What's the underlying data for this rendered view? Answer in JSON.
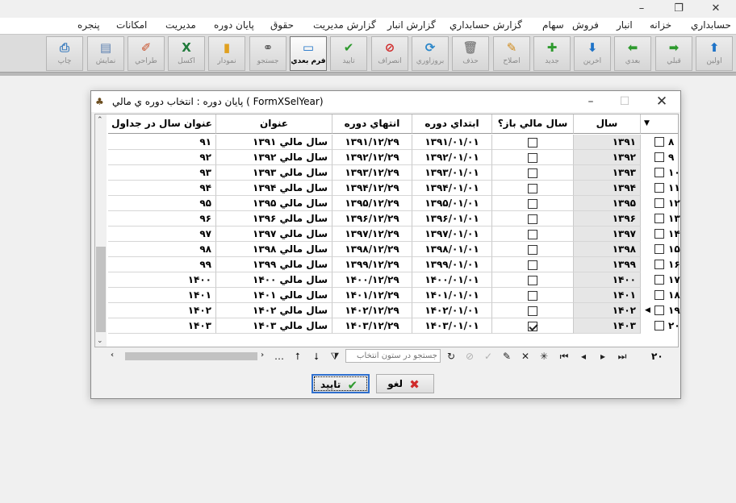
{
  "window": {
    "close_glyph": "✕",
    "restore_glyph": "❐",
    "minimize_glyph": "–"
  },
  "menu": [
    "حسابداري",
    "خزانه",
    "انبار",
    "فروش",
    "سهام",
    "گزارش حسابداري",
    "گزارش انبار",
    "گزارش مديريت",
    "حقوق",
    "پايان دوره",
    "مديريت",
    "امکانات",
    "پنجره"
  ],
  "toolbar": [
    {
      "label": "اولين",
      "icon": "arrow-up-icon",
      "glyph": "⬆",
      "color": "#1e73c8"
    },
    {
      "label": "قبلي",
      "icon": "arrow-right-icon",
      "glyph": "➡",
      "color": "#2e9a2e"
    },
    {
      "label": "بعدي",
      "icon": "arrow-left-icon",
      "glyph": "⬅",
      "color": "#2e9a2e"
    },
    {
      "label": "آخرين",
      "icon": "arrow-down-icon",
      "glyph": "⬇",
      "color": "#1e73c8"
    },
    {
      "label": "جديد",
      "icon": "plus-icon",
      "glyph": "✚",
      "color": "#2e9a2e"
    },
    {
      "label": "اصلاح",
      "icon": "pencil-icon",
      "glyph": "✎",
      "color": "#d08a1a"
    },
    {
      "label": "حذف",
      "icon": "trash-icon",
      "glyph": "🗑",
      "color": "#8a8a8a"
    },
    {
      "label": "بروزآوري",
      "icon": "refresh-icon",
      "glyph": "⟳",
      "color": "#2a86c9"
    },
    {
      "label": "انصراف",
      "icon": "cancel-icon",
      "glyph": "⊘",
      "color": "#d02b2b"
    },
    {
      "label": "تاييد",
      "icon": "check-icon",
      "glyph": "✔",
      "color": "#2e9a2e"
    },
    {
      "label": "فرم بعدي",
      "icon": "form-icon",
      "glyph": "▭",
      "color": "#1e73c8",
      "active": true
    },
    {
      "label": "جستجو",
      "icon": "binoculars-icon",
      "glyph": "⚭",
      "color": "#555555"
    },
    {
      "label": "نمودار",
      "icon": "chart-icon",
      "glyph": "▮",
      "color": "#e0a020"
    },
    {
      "label": "اکسل",
      "icon": "excel-icon",
      "glyph": "X",
      "color": "#1f7a3a"
    },
    {
      "label": "طراحي",
      "icon": "brush-icon",
      "glyph": "✐",
      "color": "#c8502a"
    },
    {
      "label": "نمايش",
      "icon": "preview-icon",
      "glyph": "▤",
      "color": "#5a7fb0"
    },
    {
      "label": "چاپ",
      "icon": "printer-icon",
      "glyph": "⎙",
      "color": "#3f7fbf"
    }
  ],
  "dialog": {
    "title": "پايان دوره : انتخاب دوره ي مالي ( FormXSelYear)",
    "columns": {
      "year": "سال",
      "open": "سال مالي باز؟",
      "start": "ابتداي دوره",
      "end": "انتهاي دوره",
      "name": "عنوان",
      "table_name": "عنوان سال در جداول"
    },
    "rows": [
      {
        "idx": "۸",
        "year": "۱۳۹۱",
        "open": false,
        "start": "۱۳۹۱/۰۱/۰۱",
        "end": "۱۳۹۱/۱۲/۲۹",
        "name": "سال مالي ۱۳۹۱",
        "table_name": "۹۱"
      },
      {
        "idx": "۹",
        "year": "۱۳۹۲",
        "open": false,
        "start": "۱۳۹۲/۰۱/۰۱",
        "end": "۱۳۹۲/۱۲/۲۹",
        "name": "سال مالي ۱۳۹۲",
        "table_name": "۹۲"
      },
      {
        "idx": "۱۰",
        "year": "۱۳۹۳",
        "open": false,
        "start": "۱۳۹۳/۰۱/۰۱",
        "end": "۱۳۹۳/۱۲/۲۹",
        "name": "سال مالي ۱۳۹۳",
        "table_name": "۹۳"
      },
      {
        "idx": "۱۱",
        "year": "۱۳۹۴",
        "open": false,
        "start": "۱۳۹۴/۰۱/۰۱",
        "end": "۱۳۹۴/۱۲/۲۹",
        "name": "سال مالي ۱۳۹۴",
        "table_name": "۹۴"
      },
      {
        "idx": "۱۲",
        "year": "۱۳۹۵",
        "open": false,
        "start": "۱۳۹۵/۰۱/۰۱",
        "end": "۱۳۹۵/۱۲/۲۹",
        "name": "سال مالي ۱۳۹۵",
        "table_name": "۹۵"
      },
      {
        "idx": "۱۳",
        "year": "۱۳۹۶",
        "open": false,
        "start": "۱۳۹۶/۰۱/۰۱",
        "end": "۱۳۹۶/۱۲/۲۹",
        "name": "سال مالي ۱۳۹۶",
        "table_name": "۹۶"
      },
      {
        "idx": "۱۴",
        "year": "۱۳۹۷",
        "open": false,
        "start": "۱۳۹۷/۰۱/۰۱",
        "end": "۱۳۹۷/۱۲/۲۹",
        "name": "سال مالي ۱۳۹۷",
        "table_name": "۹۷"
      },
      {
        "idx": "۱۵",
        "year": "۱۳۹۸",
        "open": false,
        "start": "۱۳۹۸/۰۱/۰۱",
        "end": "۱۳۹۸/۱۲/۲۹",
        "name": "سال مالي ۱۳۹۸",
        "table_name": "۹۸"
      },
      {
        "idx": "۱۶",
        "year": "۱۳۹۹",
        "open": false,
        "start": "۱۳۹۹/۰۱/۰۱",
        "end": "۱۳۹۹/۱۲/۲۹",
        "name": "سال مالي ۱۳۹۹",
        "table_name": "۹۹"
      },
      {
        "idx": "۱۷",
        "year": "۱۴۰۰",
        "open": false,
        "start": "۱۴۰۰/۰۱/۰۱",
        "end": "۱۴۰۰/۱۲/۲۹",
        "name": "سال مالي ۱۴۰۰",
        "table_name": "۱۴۰۰"
      },
      {
        "idx": "۱۸",
        "year": "۱۴۰۱",
        "open": false,
        "start": "۱۴۰۱/۰۱/۰۱",
        "end": "۱۴۰۱/۱۲/۲۹",
        "name": "سال مالي ۱۴۰۱",
        "table_name": "۱۴۰۱"
      },
      {
        "idx": "۱۹",
        "year": "۱۴۰۲",
        "open": false,
        "start": "۱۴۰۲/۰۱/۰۱",
        "end": "۱۴۰۲/۱۲/۲۹",
        "name": "سال مالي ۱۴۰۲",
        "table_name": "۱۴۰۲",
        "current": true
      },
      {
        "idx": "۲۰",
        "year": "۱۴۰۳",
        "open": true,
        "start": "۱۴۰۳/۰۱/۰۱",
        "end": "۱۴۰۳/۱۲/۲۹",
        "name": "سال مالي ۱۴۰۳",
        "table_name": "۱۴۰۳"
      }
    ],
    "navigator": {
      "search_placeholder": "جستجو در ستون انتخاب",
      "record_count": "۲۰",
      "more_glyph": "…"
    },
    "buttons": {
      "ok": "تاييد",
      "cancel": "لغو"
    }
  }
}
